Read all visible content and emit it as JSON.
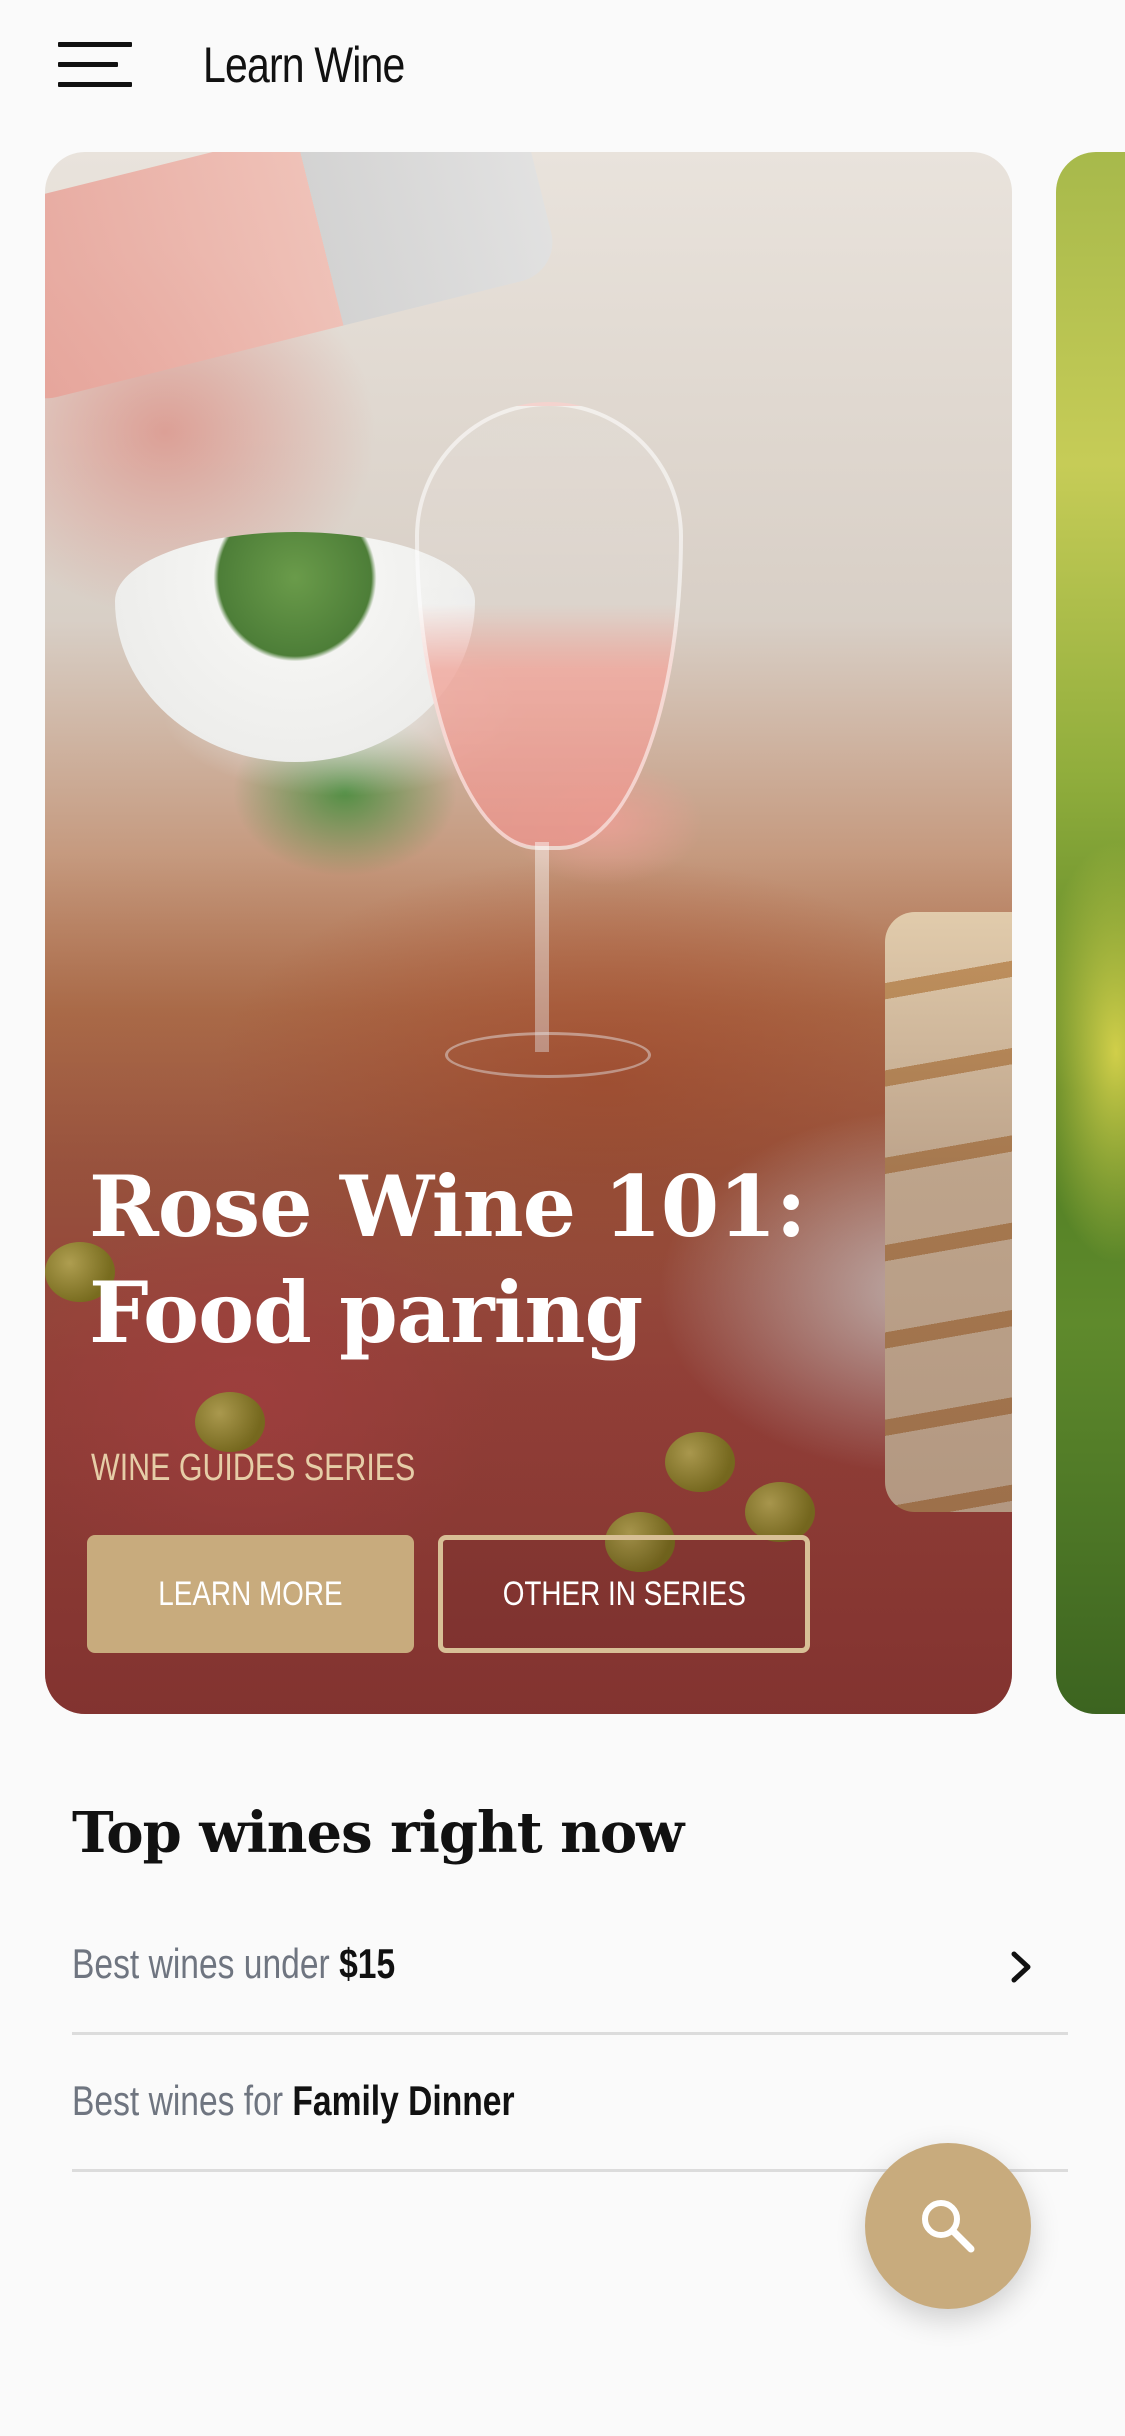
{
  "header": {
    "menu_icon": "hamburger-menu-icon",
    "title": "Learn Wine"
  },
  "featured_card": {
    "title": "Rose Wine 101: Food paring",
    "series": "WINE GUIDES SERIES",
    "learn_more_label": "LEARN MORE",
    "other_in_series_label": "OTHER IN SERIES",
    "image": "rose-wine-pour-food-photo"
  },
  "next_card": {
    "image": "vineyard-landscape-photo"
  },
  "top_wines": {
    "title": "Top wines right now",
    "items": [
      {
        "prefix": "Best wines under ",
        "highlight": "$15",
        "icon": "chevron-right-icon"
      },
      {
        "prefix": "Best wines for ",
        "highlight": "Family Dinner"
      }
    ]
  },
  "fab": {
    "icon": "search-icon"
  },
  "colors": {
    "accent": "#c8ab7d",
    "text": "#111111",
    "muted": "#6f7580",
    "divider": "#dcdcdc"
  }
}
